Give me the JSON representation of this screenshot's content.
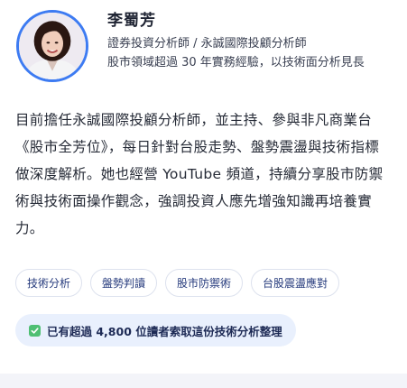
{
  "profile": {
    "name": "李蜀芳",
    "title": "證券投資分析師 / 永誠國際投顧分析師",
    "experience": "股市領域超過 30 年實務經驗，以技術面分析見長",
    "avatar_icon": "portrait-photo"
  },
  "bio": "目前擔任永誠國際投顧分析師，並主持、參與非凡商業台《股市全芳位》，每日針對台股走勢、盤勢震盪與技術指標做深度解析。她也經營 YouTube 頻道，持續分享股市防禦術與技術面操作觀念，強調投資人應先增強知識再培養實力。",
  "tags": [
    {
      "label": "技術分析"
    },
    {
      "label": "盤勢判讀"
    },
    {
      "label": "股市防禦術"
    },
    {
      "label": "台股震盪應對"
    }
  ],
  "notice": {
    "icon": "check-icon",
    "text": "已有超過 4,800 位讀者索取這份技術分析整理"
  },
  "colors": {
    "accent": "#3d7bf2",
    "tag_text": "#253a7c",
    "notice_bg": "#e9f0fd",
    "check": "#4fbf73"
  }
}
